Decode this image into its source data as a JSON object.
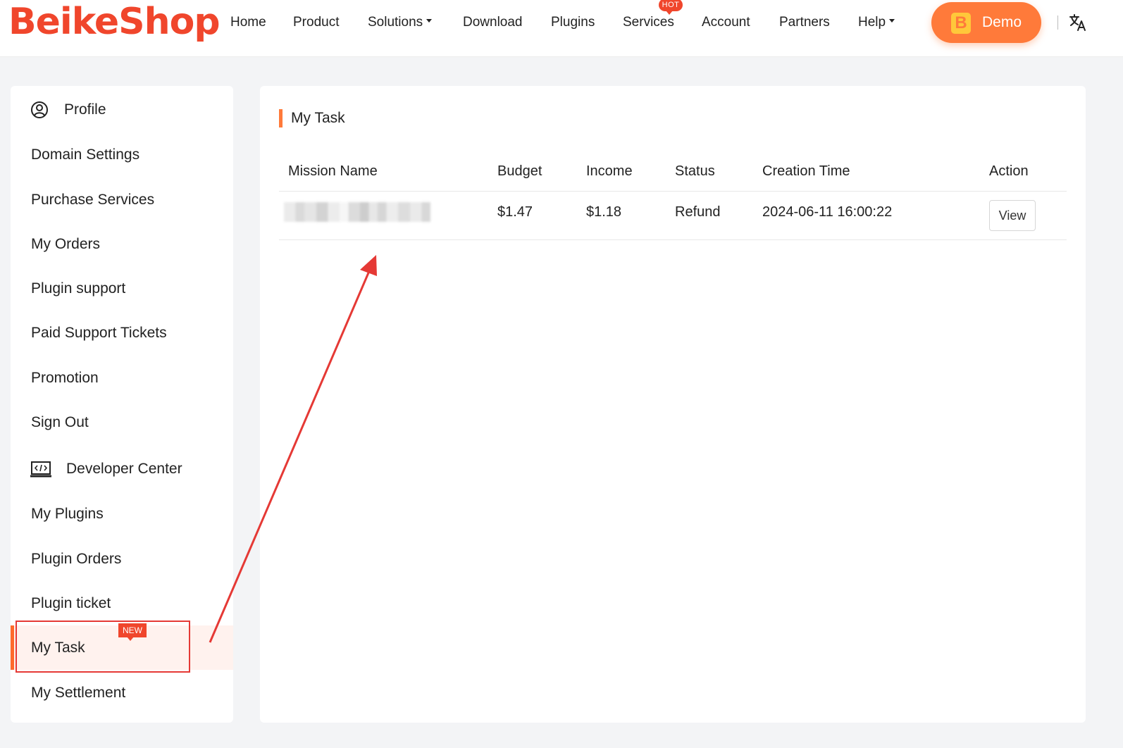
{
  "header": {
    "logo": "BeikeShop",
    "nav": [
      {
        "label": "Home"
      },
      {
        "label": "Product"
      },
      {
        "label": "Solutions"
      },
      {
        "label": "Download"
      },
      {
        "label": "Plugins"
      },
      {
        "label": "Services"
      },
      {
        "label": "Account"
      },
      {
        "label": "Partners"
      },
      {
        "label": "Help"
      }
    ],
    "hot_badge": "HOT",
    "demo_label": "Demo",
    "demo_icon_letter": "B",
    "language_icon": "translate-icon"
  },
  "sidebar": {
    "items": [
      {
        "label": "Profile",
        "icon": "user-circle-icon"
      },
      {
        "label": "Domain Settings"
      },
      {
        "label": "Purchase Services"
      },
      {
        "label": "My Orders"
      },
      {
        "label": "Plugin support"
      },
      {
        "label": "Paid Support Tickets"
      },
      {
        "label": "Promotion"
      },
      {
        "label": "Sign Out"
      },
      {
        "label": "Developer Center",
        "icon": "code-monitor-icon"
      },
      {
        "label": "My Plugins"
      },
      {
        "label": "Plugin Orders"
      },
      {
        "label": "Plugin ticket"
      },
      {
        "label": "My Task",
        "badge": "NEW",
        "active": true
      },
      {
        "label": "My Settlement"
      }
    ]
  },
  "main": {
    "title": "My Task",
    "table": {
      "columns": [
        "Mission Name",
        "Budget",
        "Income",
        "Status",
        "Creation Time",
        "Action"
      ],
      "rows": [
        {
          "mission_name": "",
          "budget": "$1.47",
          "income": "$1.18",
          "status": "Refund",
          "creation_time": "2024-06-11 16:00:22",
          "action": "View"
        }
      ]
    }
  },
  "colors": {
    "brand": "#f0462c",
    "accent": "#ff7a3a",
    "active_bg": "#fff2ee",
    "annotation": "#e53935"
  }
}
